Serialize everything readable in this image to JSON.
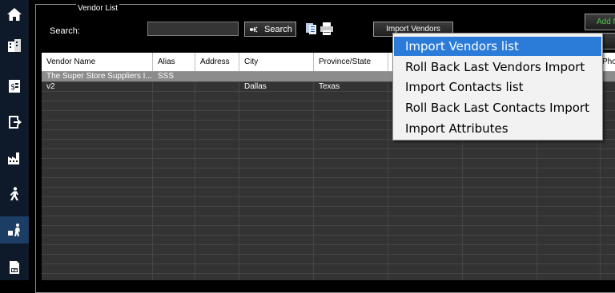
{
  "nav": {
    "items": [
      {
        "name": "home-icon",
        "active": false
      },
      {
        "name": "building-icon",
        "active": false
      },
      {
        "name": "invoice-icon",
        "active": false
      },
      {
        "name": "exit-icon",
        "active": false
      },
      {
        "name": "factory-icon",
        "active": false
      },
      {
        "name": "person-walk-icon",
        "active": false
      },
      {
        "name": "vendor-icon",
        "active": true
      },
      {
        "name": "report-icon",
        "active": false
      }
    ]
  },
  "group": {
    "legend": "Vendor List"
  },
  "search": {
    "label": "Search:",
    "value": "",
    "button_label": "Search"
  },
  "toolbar": {
    "import_label": "Import Vendors",
    "add_label": "Add N"
  },
  "grid": {
    "columns": [
      "Vendor Name",
      "Alias",
      "Address",
      "City",
      "Province/State",
      "",
      "",
      "",
      "Pho"
    ],
    "rows": [
      {
        "vendor_name": "The Super Store Suppliers I...",
        "alias": "SSS",
        "address": "",
        "city": "",
        "province": "",
        "selected": true
      },
      {
        "vendor_name": "v2",
        "alias": "",
        "address": "",
        "city": "Dallas",
        "province": "Texas",
        "selected": false
      }
    ]
  },
  "menu": {
    "items": [
      {
        "label": "Import Vendors list",
        "highlighted": true
      },
      {
        "label": "Roll Back Last Vendors Import",
        "highlighted": false
      },
      {
        "label": "Import Contacts list",
        "highlighted": false
      },
      {
        "label": "Roll Back Last Contacts Import",
        "highlighted": false
      },
      {
        "label": "Import Attributes",
        "highlighted": false
      }
    ]
  },
  "colors": {
    "accent": "#2b7bd8",
    "nav_bg": "#0e1a2a",
    "nav_active": "#1c3d64",
    "grid_bg": "#333333",
    "add_text": "#4ec24e"
  }
}
